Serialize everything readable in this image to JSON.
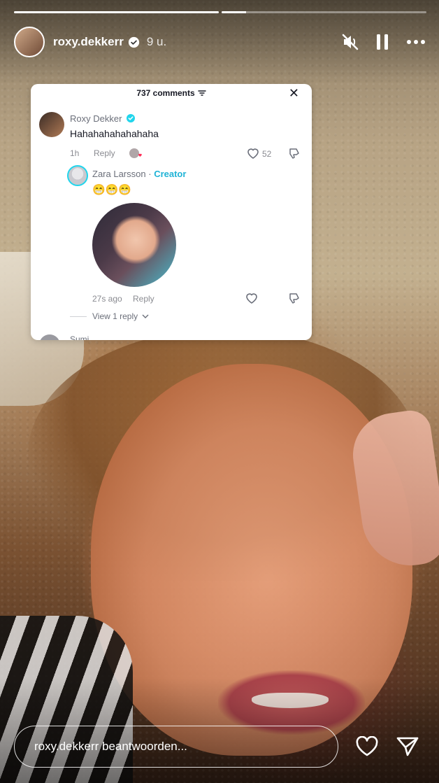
{
  "story": {
    "progress": [
      1.0,
      0.12
    ],
    "username": "roxy.dekkerr",
    "time": "9 u."
  },
  "icons": {
    "mute": "speaker-muted-icon",
    "pause": "pause-icon",
    "more": "more-horizontal-icon",
    "like": "heart-icon",
    "share": "send-icon"
  },
  "card": {
    "comments_count": "737 comments",
    "comment1": {
      "author": "Roxy Dekker",
      "text": "Hahahahahahahaha",
      "time": "1h",
      "reply_label": "Reply",
      "likes": "52"
    },
    "comment2": {
      "author": "Zara Larsson",
      "separator": "·",
      "badge": "Creator",
      "emojis": "😁😁😁",
      "time": "27s ago",
      "reply_label": "Reply",
      "view_replies": "View 1 reply"
    },
    "next_author": "Sumi"
  },
  "bottom": {
    "reply_placeholder": "roxy.dekkerr beantwoorden..."
  }
}
